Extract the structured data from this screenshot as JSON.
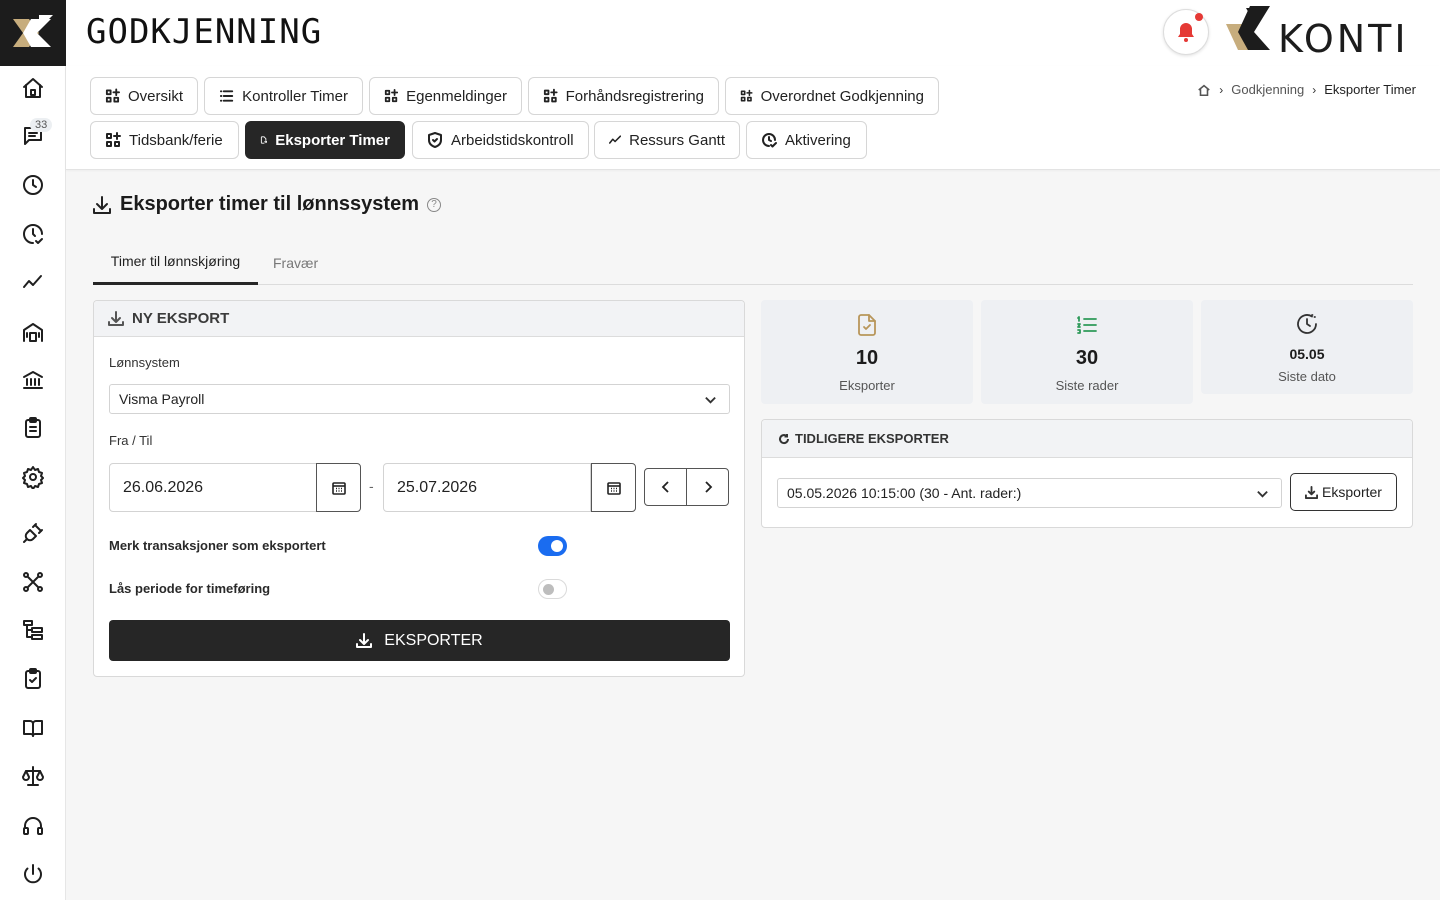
{
  "header": {
    "title": "GODKJENNING",
    "brand_name": "KONTI"
  },
  "sidebar": {
    "messages_badge": "33",
    "items": [
      "home-icon",
      "messages-icon",
      "clock-icon",
      "clock-check-icon",
      "trend-icon",
      "building-icon",
      "bank-icon",
      "clipboard-list-icon",
      "gear-icon",
      "plug-icon",
      "network-icon",
      "tree-icon",
      "clipboard-check-icon",
      "book-icon",
      "scale-icon",
      "headset-icon",
      "power-icon"
    ]
  },
  "nav": {
    "row1": [
      {
        "label": "Oversikt",
        "icon": "grid-icon"
      },
      {
        "label": "Kontroller Timer",
        "icon": "list-icon"
      },
      {
        "label": "Egenmeldinger",
        "icon": "grid-icon"
      },
      {
        "label": "Forhåndsregistrering",
        "icon": "grid-icon"
      },
      {
        "label": "Overordnet Godkjenning",
        "icon": "grid-icon"
      }
    ],
    "row2": [
      {
        "label": "Tidsbank/ferie",
        "icon": "grid-icon"
      },
      {
        "label": "Eksporter Timer",
        "icon": "file-export-icon"
      },
      {
        "label": "Arbeidstidskontroll",
        "icon": "shield-icon"
      },
      {
        "label": "Ressurs Gantt",
        "icon": "trend-icon"
      },
      {
        "label": "Aktivering",
        "icon": "clock-check-icon"
      }
    ]
  },
  "breadcrumb": {
    "parent": "Godkjenning",
    "current": "Eksporter Timer"
  },
  "content": {
    "title": "Eksporter timer til lønnssystem",
    "help": "?"
  },
  "tabs": {
    "active": "Timer til lønnskjøring",
    "inactive": "Fravær"
  },
  "new_export": {
    "heading": "NY EKSPORT",
    "payroll_label": "Lønnsystem",
    "payroll_value": "Visma Payroll",
    "range_label": "Fra / Til",
    "from": "26.06.2026",
    "range_sep": "-",
    "to": "25.07.2026",
    "mark_label": "Merk transaksjoner som eksportert",
    "mark_on": true,
    "lock_label": "Lås periode for timeføring",
    "lock_on": false,
    "export_button": "EKSPORTER"
  },
  "stats": [
    {
      "value": "10",
      "caption": "Eksporter",
      "icon": "file-check-icon",
      "color": "#b8965a"
    },
    {
      "value": "30",
      "caption": "Siste rader",
      "icon": "list-numbered-icon",
      "color": "#2e9a5a"
    },
    {
      "value": "05.05",
      "caption": "Siste dato",
      "icon": "clock-icon",
      "color": "#333333"
    }
  ],
  "previous": {
    "heading": "TIDLIGERE EKSPORTER",
    "selected": "05.05.2026 10:15:00 (30 - Ant. rader:)",
    "button": "Eksporter"
  },
  "colors": {
    "accent_dark": "#262626",
    "toggle_on": "#1a6cf0",
    "notification": "#e53935",
    "brand_gold": "#b8965a"
  }
}
